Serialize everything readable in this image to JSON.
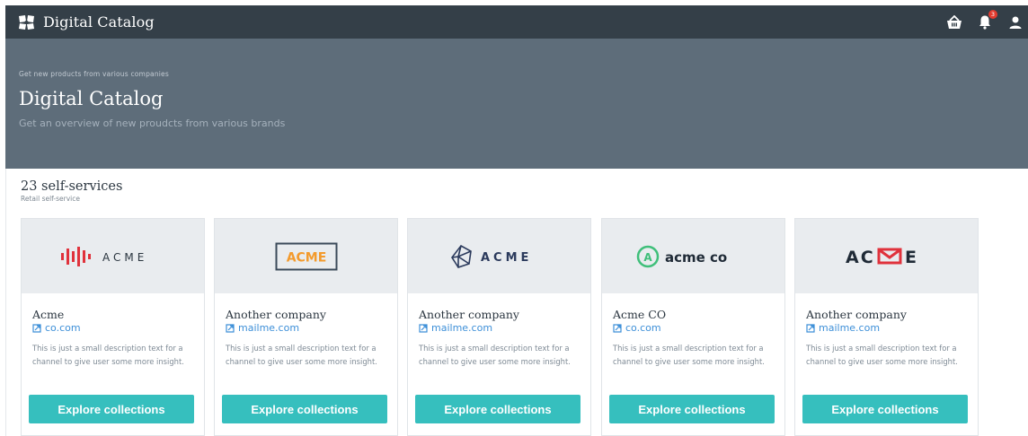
{
  "app": {
    "title": "Digital Catalog"
  },
  "header": {
    "notification_count": "3"
  },
  "hero": {
    "eyebrow": "Get new products from various companies",
    "title": "Digital Catalog",
    "subtitle": "Get an overview of new proudcts from various brands"
  },
  "section": {
    "title": "23 self-services",
    "subtitle": "Retail self-service"
  },
  "cards": [
    {
      "logo_text": "ACME",
      "name": "Acme",
      "link": "co.com",
      "description": "This is just a small description text for a channel to give user some more insight.",
      "button": "Explore collections"
    },
    {
      "logo_text": "ACME",
      "name": "Another company",
      "link": "mailme.com",
      "description": "This is just a small description text for a channel to give user some more insight.",
      "button": "Explore collections"
    },
    {
      "logo_text": "ACME",
      "name": "Another company",
      "link": "mailme.com",
      "description": "This is just a small description text for a channel to give user some more insight.",
      "button": "Explore collections"
    },
    {
      "logo_text": "acme co",
      "name": "Acme CO",
      "link": "co.com",
      "description": "This is just a small description text for a channel to give user some more insight.",
      "button": "Explore collections"
    },
    {
      "logo_text": "AC_E",
      "name": "Another company",
      "link": "mailme.com",
      "description": "This is just a small description text for a channel to give user some more insight.",
      "button": "Explore collections"
    }
  ],
  "colors": {
    "topbar": "#343f48",
    "hero": "#5e6d7a",
    "accent": "#36bfbe",
    "link": "#3d8fd8",
    "badge": "#e23b2f"
  },
  "icons": [
    "app-logo-icon",
    "basket-icon",
    "bell-icon",
    "user-icon",
    "external-link-icon"
  ]
}
